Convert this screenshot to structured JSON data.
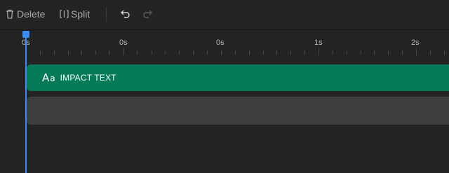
{
  "toolbar": {
    "delete_label": "Delete",
    "split_label": "Split",
    "icons": [
      "trash-icon",
      "split-icon",
      "undo-icon",
      "redo-icon"
    ]
  },
  "ruler": {
    "labels": [
      "0s",
      "0s",
      "0s",
      "1s",
      "2s"
    ]
  },
  "tracks": {
    "text_clip": {
      "icon_glyph_big": "A",
      "icon_glyph_small": "a",
      "label": "IMPACT TEXT"
    }
  },
  "colors": {
    "background": "#232323",
    "text_clip": "#047a59",
    "empty_track": "#3e3e3e",
    "playhead": "#3a8cf0"
  }
}
